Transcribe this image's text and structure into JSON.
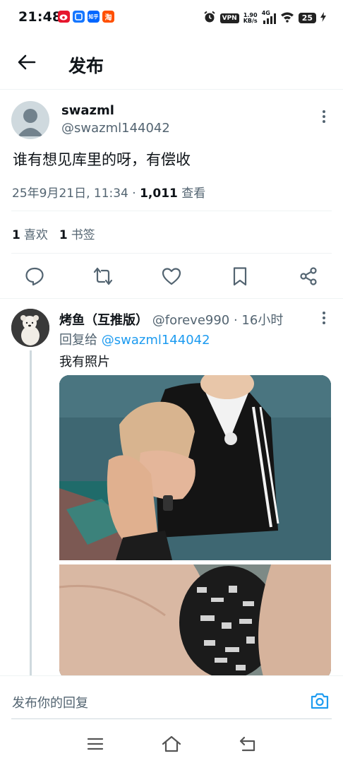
{
  "status_bar": {
    "time": "21:48",
    "app_icons": [
      {
        "name": "weibo-icon",
        "color": "#e6162d",
        "label": ""
      },
      {
        "name": "alipay-icon",
        "color": "#1677ff",
        "label": ""
      },
      {
        "name": "zhihu-icon",
        "color": "#0066ff",
        "label": "知乎"
      },
      {
        "name": "taobao-icon",
        "color": "#ff5000",
        "label": "淘"
      }
    ],
    "vpn": "VPN",
    "net_speed_value": "1.90",
    "net_speed_unit": "KB/s",
    "network": "4G",
    "battery": "25"
  },
  "header": {
    "title": "发布"
  },
  "post": {
    "author_name": "swazml",
    "author_handle": "@swazml144042",
    "text": "谁有想见库里的呀，有偿收",
    "timestamp": "25年9月21日, 11:34 · ",
    "views_count": "1,011",
    "views_label": " 查看",
    "likes_count": "1",
    "likes_label": "喜欢",
    "bookmarks_count": "1",
    "bookmarks_label": "书签"
  },
  "reply": {
    "author_name": "烤鱼（互推版）",
    "author_handle": "@foreve990",
    "time": " · 16小时",
    "replying_prefix": "回复给 ",
    "replying_to": "@swazml144042",
    "text": "我有照片"
  },
  "compose": {
    "placeholder": "发布你的回复"
  },
  "colors": {
    "accent": "#1d9bf0",
    "secondary_text": "#536471",
    "primary_text": "#0f1419",
    "divider": "#eff3f4"
  }
}
